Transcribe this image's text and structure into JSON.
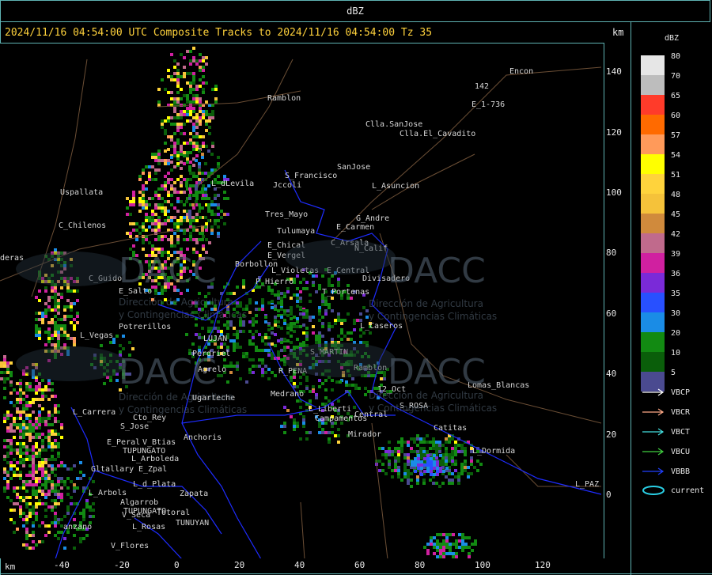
{
  "top_title": "dBZ",
  "header_text": "2024/11/16 04:54:00 UTC Composite Tracks to 2024/11/16 04:54:00 Tz 35",
  "km_label": "km",
  "legend": {
    "title": "dBZ",
    "levels": [
      {
        "label": "80",
        "color": "#e6e6e6"
      },
      {
        "label": "70",
        "color": "#bdbdbd"
      },
      {
        "label": "65",
        "color": "#ff3b2a"
      },
      {
        "label": "60",
        "color": "#ff6a00"
      },
      {
        "label": "57",
        "color": "#ff9a5a"
      },
      {
        "label": "54",
        "color": "#ffff00"
      },
      {
        "label": "51",
        "color": "#ffd33c"
      },
      {
        "label": "48",
        "color": "#f5c23a"
      },
      {
        "label": "45",
        "color": "#d08a3c"
      },
      {
        "label": "42",
        "color": "#c06a8c"
      },
      {
        "label": "39",
        "color": "#d020a0"
      },
      {
        "label": "36",
        "color": "#7a2ad8"
      },
      {
        "label": "35",
        "color": "#2850ff"
      },
      {
        "label": "30",
        "color": "#1a8ce6"
      },
      {
        "label": "20",
        "color": "#128a12"
      },
      {
        "label": "10",
        "color": "#0a5e0a"
      },
      {
        "label": "5",
        "color": "#4a4a90"
      }
    ],
    "tracks": [
      {
        "label": "VBCP",
        "color": "#ffffff"
      },
      {
        "label": "VBCR",
        "color": "#ffaa88"
      },
      {
        "label": "VBCT",
        "color": "#44e0e0"
      },
      {
        "label": "VBCU",
        "color": "#40d040"
      },
      {
        "label": "VBBB",
        "color": "#2040ff"
      }
    ],
    "current_label": "current",
    "current_color": "#2ad0e6"
  },
  "x_ticks": [
    "-40",
    "-20",
    "0",
    "20",
    "40",
    "60",
    "80",
    "100",
    "120"
  ],
  "y_ticks": [
    "140",
    "120",
    "100",
    "80",
    "60",
    "40",
    "20",
    "0"
  ],
  "places": [
    {
      "name": "Encon"
    },
    {
      "name": "142"
    },
    {
      "name": "E_1-736"
    },
    {
      "name": "Ramblon"
    },
    {
      "name": "Clla.SanJose"
    },
    {
      "name": "Clla.El_Cavadito"
    },
    {
      "name": "S_Francisco"
    },
    {
      "name": "Jccoli"
    },
    {
      "name": "SanJose"
    },
    {
      "name": "L_Asuncion"
    },
    {
      "name": "Uspallata"
    },
    {
      "name": "L_dLevila"
    },
    {
      "name": "Tres_Mayo"
    },
    {
      "name": "G_Andre"
    },
    {
      "name": "E_Carmen"
    },
    {
      "name": "C_Chilenos"
    },
    {
      "name": "Tulumaya"
    },
    {
      "name": "C_Arsala"
    },
    {
      "name": "E_Chical"
    },
    {
      "name": "N_Calif"
    },
    {
      "name": "E_Vergel"
    },
    {
      "name": "Borbollon"
    },
    {
      "name": "deras"
    },
    {
      "name": "L_Violetas"
    },
    {
      "name": "E_Central"
    },
    {
      "name": "Divisadero"
    },
    {
      "name": "C_Guido"
    },
    {
      "name": "P_Hierro"
    },
    {
      "name": "E_Salto"
    },
    {
      "name": "T_Portenas"
    },
    {
      "name": "Potrerillos"
    },
    {
      "name": "L_Caseros"
    },
    {
      "name": "L_Vegas"
    },
    {
      "name": "LUJAN"
    },
    {
      "name": "S_MARTIN"
    },
    {
      "name": "Perdriel"
    },
    {
      "name": "Agrelo"
    },
    {
      "name": "Ramblon"
    },
    {
      "name": "R_PENA"
    },
    {
      "name": "Lomas_Blancas"
    },
    {
      "name": "12_Oct"
    },
    {
      "name": "Ugarteche"
    },
    {
      "name": "Medrano"
    },
    {
      "name": "L_Liberti"
    },
    {
      "name": "S_ROSA"
    },
    {
      "name": "L_Carrera"
    },
    {
      "name": "Cto_Rey"
    },
    {
      "name": "Campamentos"
    },
    {
      "name": "Central"
    },
    {
      "name": "S_Jose"
    },
    {
      "name": "Catitas"
    },
    {
      "name": "Anchoris"
    },
    {
      "name": "Mirador"
    },
    {
      "name": "E_Peral"
    },
    {
      "name": "V_Btias"
    },
    {
      "name": "TUPUNGATO"
    },
    {
      "name": "L_Dormida"
    },
    {
      "name": "L_Arboleda"
    },
    {
      "name": "Gltallary"
    },
    {
      "name": "E_Zpal"
    },
    {
      "name": "L_d_Plata"
    },
    {
      "name": "L_PAZ"
    },
    {
      "name": "L_Arbols"
    },
    {
      "name": "Zapata"
    },
    {
      "name": "Algarrob"
    },
    {
      "name": "TUPUNGATO"
    },
    {
      "name": "V_Seca"
    },
    {
      "name": "Totoral"
    },
    {
      "name": "anzano"
    },
    {
      "name": "L_Rosas"
    },
    {
      "name": "TUNUYAN"
    },
    {
      "name": "V_Flores"
    }
  ],
  "watermark": {
    "brand": "DACC",
    "line1": "Dirección de Agricultura",
    "line2": "y Contingencias Climáticas"
  }
}
